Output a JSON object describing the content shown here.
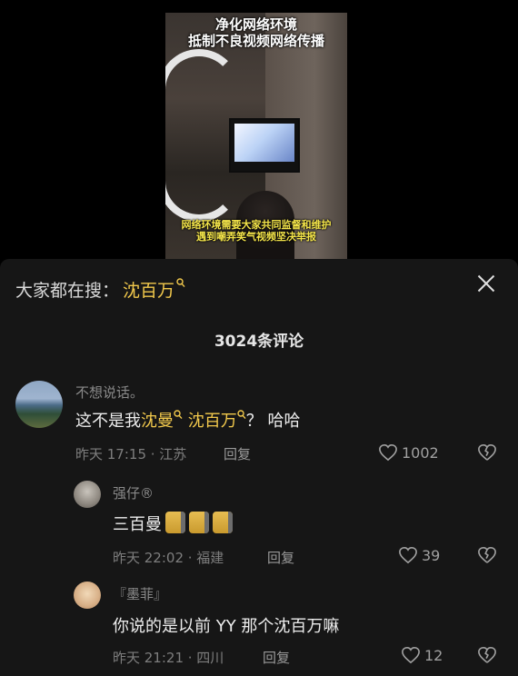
{
  "video": {
    "title_line1": "净化网络环境",
    "title_line2": "抵制不良视频网络传播",
    "caption_line1": "网络环境需要大家共同监督和维护",
    "caption_line2": "遇到嘲弄笑气视频坚决举报"
  },
  "search": {
    "prefix": "大家都在搜：",
    "keyword": "沈百万",
    "search_icon": "search-icon"
  },
  "close_icon": "close-icon",
  "comments_header": "3024条评论",
  "comments": [
    {
      "username": "不想说话。",
      "text_before": "这不是我",
      "link1": "沈曼",
      "text_middle": " ",
      "link2": "沈百万",
      "text_after": "？ 哈哈",
      "meta": "昨天 17:15 · 江苏",
      "reply_label": "回复",
      "likes": "1002"
    },
    {
      "username": "强仔®",
      "text": "三百曼",
      "emoji_count": 3,
      "meta": "昨天 22:02 · 福建",
      "reply_label": "回复",
      "likes": "39"
    },
    {
      "username": "『墨菲』",
      "text": "你说的是以前 YY 那个沈百万嘛",
      "meta": "昨天 21:21 · 四川",
      "reply_label": "回复",
      "likes": "12"
    }
  ],
  "colors": {
    "highlight": "#f2c94c",
    "sheet_bg": "#161616",
    "text": "#ededed",
    "muted": "#7e7e7e"
  }
}
